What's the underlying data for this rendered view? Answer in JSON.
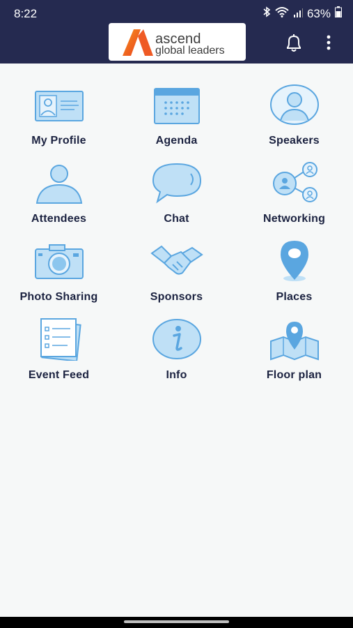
{
  "status": {
    "time": "8:22",
    "battery": "63%"
  },
  "app": {
    "logo_line1": "ascend",
    "logo_line2": "global leaders",
    "brand_color": "#252a50",
    "icon_color": "#5aa6e0"
  },
  "tiles": [
    {
      "label": "My Profile",
      "icon": "id-card-icon"
    },
    {
      "label": "Agenda",
      "icon": "calendar-icon"
    },
    {
      "label": "Speakers",
      "icon": "speaker-avatar-icon"
    },
    {
      "label": "Attendees",
      "icon": "person-icon"
    },
    {
      "label": "Chat",
      "icon": "chat-bubble-icon"
    },
    {
      "label": "Networking",
      "icon": "network-icon"
    },
    {
      "label": "Photo Sharing",
      "icon": "camera-icon"
    },
    {
      "label": "Sponsors",
      "icon": "handshake-icon"
    },
    {
      "label": "Places",
      "icon": "map-pin-icon"
    },
    {
      "label": "Event Feed",
      "icon": "feed-cards-icon"
    },
    {
      "label": "Info",
      "icon": "info-icon"
    },
    {
      "label": "Floor plan",
      "icon": "floor-plan-map-icon"
    }
  ]
}
